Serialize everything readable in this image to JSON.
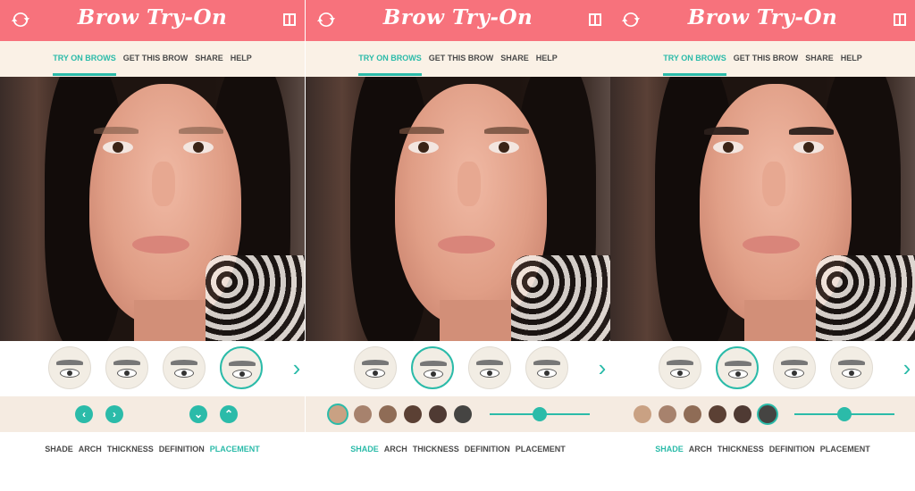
{
  "accent_color": "#2bbba9",
  "header_color": "#f7727c",
  "screens": [
    {
      "title": "Brow Try-On",
      "nav": [
        "TRY ON BROWS",
        "GET THIS BROW",
        "SHARE",
        "HELP"
      ],
      "active_nav": 0,
      "bottom_tabs": [
        "SHADE",
        "ARCH",
        "THICKNESS",
        "DEFINITION",
        "PLACEMENT"
      ],
      "active_bottom_tab": 4
    },
    {
      "title": "Brow Try-On",
      "nav": [
        "TRY ON BROWS",
        "GET THIS BROW",
        "SHARE",
        "HELP"
      ],
      "active_nav": 0,
      "bottom_tabs": [
        "SHADE",
        "ARCH",
        "THICKNESS",
        "DEFINITION",
        "PLACEMENT"
      ],
      "active_bottom_tab": 0,
      "shade_swatches": [
        "#c9a183",
        "#a7826d",
        "#8f6c56",
        "#5b4034",
        "#4f3a33",
        "#454442"
      ],
      "selected_swatch": 0,
      "slider_value": 0.5
    },
    {
      "title": "Brow Try-On",
      "nav": [
        "TRY ON BROWS",
        "GET THIS BROW",
        "SHARE",
        "HELP"
      ],
      "active_nav": 0,
      "bottom_tabs": [
        "SHADE",
        "ARCH",
        "THICKNESS",
        "DEFINITION",
        "PLACEMENT"
      ],
      "active_bottom_tab": 0,
      "shade_swatches": [
        "#c9a183",
        "#a7826d",
        "#8f6c56",
        "#5b4034",
        "#4f3a33",
        "#454442"
      ],
      "selected_swatch": 5,
      "slider_value": 0.5
    }
  ]
}
